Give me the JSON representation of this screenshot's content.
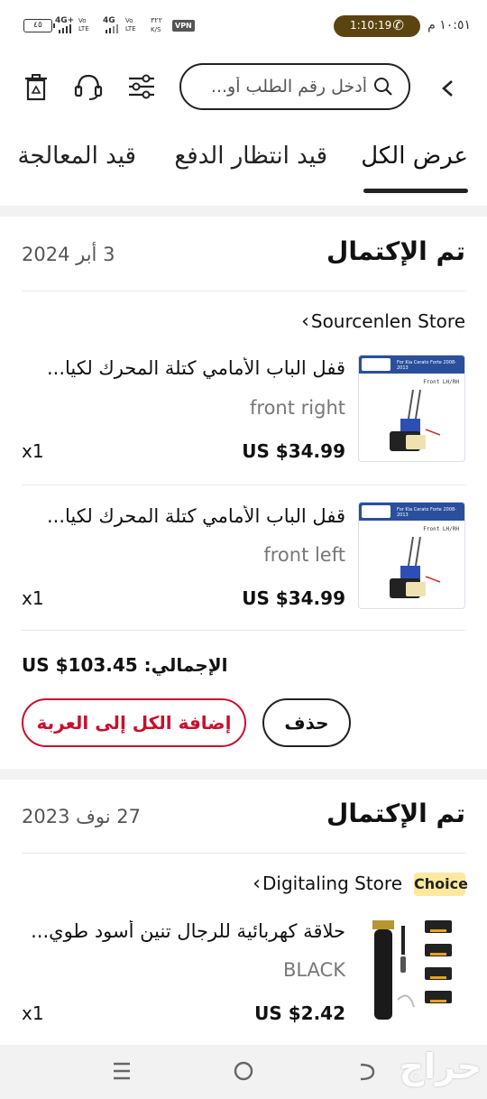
{
  "status_bar": {
    "battery": "٤٥",
    "net1": "4G+",
    "net1_sub": "Vo LTE",
    "net2": "4G",
    "net2_sub": "Vo LTE",
    "speed": "٣٢٢",
    "speed_unit": "K/S",
    "vpn": "VPN",
    "call_time": "1:10:19",
    "clock": "١٠:٥١ م"
  },
  "header": {
    "search_placeholder": "أدخل رقم الطلب أو..."
  },
  "tabs": [
    {
      "label": "عرض الكل",
      "active": true
    },
    {
      "label": "قيد انتظار الدفع",
      "active": false
    },
    {
      "label": "قيد المعالجة",
      "active": false
    }
  ],
  "orders": [
    {
      "status": "تم الإكتمال",
      "date": "3 أبر 2024",
      "store": "Sourcenlen Store",
      "items": [
        {
          "name": "قفل الباب الأمامي كتلة المحرك لكيا...",
          "variant": "front right",
          "price": "US $34.99",
          "qty": "x1",
          "img_caption": "For Kia Cerato Forte 2008-2013",
          "img_sub": "Front LH/RH"
        },
        {
          "name": "قفل الباب الأمامي كتلة المحرك لكيا...",
          "variant": "front left",
          "price": "US $34.99",
          "qty": "x1",
          "img_caption": "For Kia Cerato Forte 2008-2013",
          "img_sub": "Front LH/RH"
        }
      ],
      "total": "الإجمالي: US $103.45",
      "delete_label": "حذف",
      "add_all_label": "إضافة الكل إلى العربة"
    },
    {
      "status": "تم الإكتمال",
      "date": "27 نوف 2023",
      "store": "Digitaling Store",
      "badge": "Choice",
      "items": [
        {
          "name": "حلاقة كهربائية للرجال تنين أسود طوي...",
          "variant": "BLACK",
          "price": "US $2.42",
          "qty": "x1"
        }
      ]
    }
  ],
  "watermark": "حراج",
  "colors": {
    "accent": "#c8102e",
    "call_pill": "#5c4410",
    "choice_badge": "#fde8a0"
  }
}
